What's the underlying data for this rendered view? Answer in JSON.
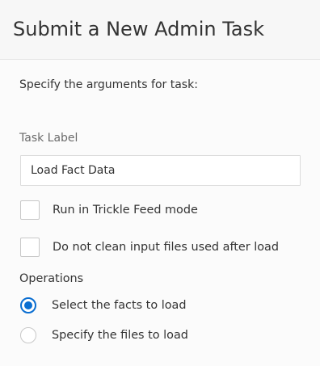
{
  "header": {
    "title": "Submit a New Admin Task"
  },
  "form": {
    "instruction": "Specify the arguments for task:",
    "task_label": {
      "label": "Task Label",
      "value": "Load Fact Data"
    },
    "checkboxes": [
      {
        "label": "Run in Trickle Feed mode",
        "checked": false
      },
      {
        "label": "Do not clean input files used after load",
        "checked": false
      }
    ],
    "operations": {
      "label": "Operations",
      "options": [
        {
          "label": "Select the facts to load",
          "selected": true
        },
        {
          "label": "Specify the files to load",
          "selected": false
        }
      ]
    }
  },
  "colors": {
    "accent": "#0a6ed1",
    "header_bg": "#f7f7f7",
    "panel_bg": "#fbfbfb"
  }
}
